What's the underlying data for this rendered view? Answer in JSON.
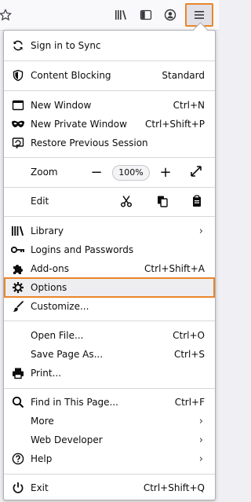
{
  "toolbar": {
    "icons": [
      "star-icon",
      "library-icon",
      "sidebar-icon",
      "account-icon",
      "hamburger-menu-icon"
    ]
  },
  "menu": {
    "sign_in": "Sign in to Sync",
    "content_blocking": "Content Blocking",
    "content_blocking_status": "Standard",
    "new_window": "New Window",
    "new_window_shortcut": "Ctrl+N",
    "new_private_window": "New Private Window",
    "new_private_window_shortcut": "Ctrl+Shift+P",
    "restore_session": "Restore Previous Session",
    "zoom": "Zoom",
    "zoom_minus": "−",
    "zoom_level": "100%",
    "zoom_plus": "+",
    "edit": "Edit",
    "library": "Library",
    "logins": "Logins and Passwords",
    "addons": "Add-ons",
    "addons_shortcut": "Ctrl+Shift+A",
    "options": "Options",
    "customize": "Customize...",
    "open_file": "Open File...",
    "open_file_shortcut": "Ctrl+O",
    "save_page": "Save Page As...",
    "save_page_shortcut": "Ctrl+S",
    "print": "Print...",
    "find": "Find in This Page...",
    "find_shortcut": "Ctrl+F",
    "more": "More",
    "web_developer": "Web Developer",
    "help": "Help",
    "exit": "Exit",
    "exit_shortcut": "Ctrl+Shift+Q",
    "chevron": "›"
  },
  "colors": {
    "highlight_border": "#e8852a",
    "text": "#0c0c0d"
  }
}
